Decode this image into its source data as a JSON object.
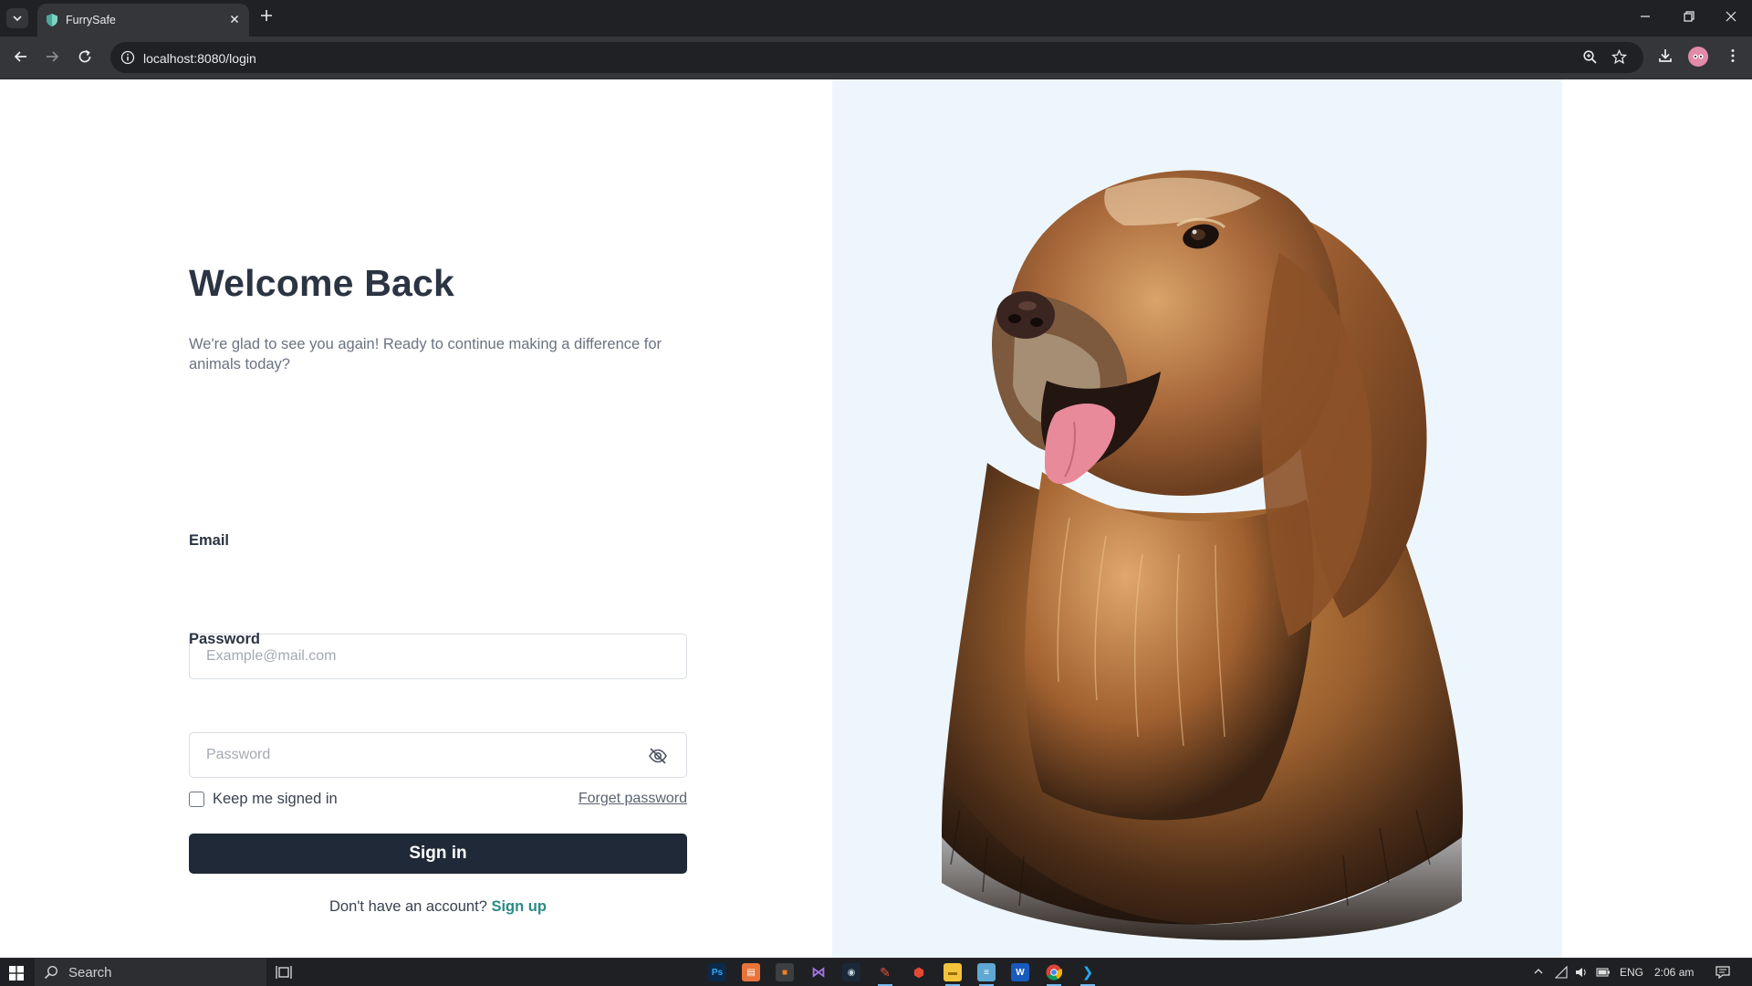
{
  "browser": {
    "tab_title": "FurrySafe",
    "url": "localhost:8080/login"
  },
  "login": {
    "heading": "Welcome Back",
    "subtitle": "We're glad to see you again! Ready to continue making a difference for animals today?",
    "email_label": "Email",
    "email_placeholder": "Example@mail.com",
    "password_label": "Password",
    "password_placeholder": "Password",
    "remember_label": "Keep me signed in",
    "remember_checked": false,
    "forgot_label": "Forget password",
    "signin_label": "Sign in",
    "signup_prompt": "Don't have an account?",
    "signup_link": "Sign up"
  },
  "taskbar": {
    "search_label": "Search",
    "language": "ENG",
    "time": "2:06 am"
  },
  "colors": {
    "primary_button": "#1f2937",
    "link_accent": "#2a8b85",
    "image_panel_bg": "#eef6fd"
  }
}
